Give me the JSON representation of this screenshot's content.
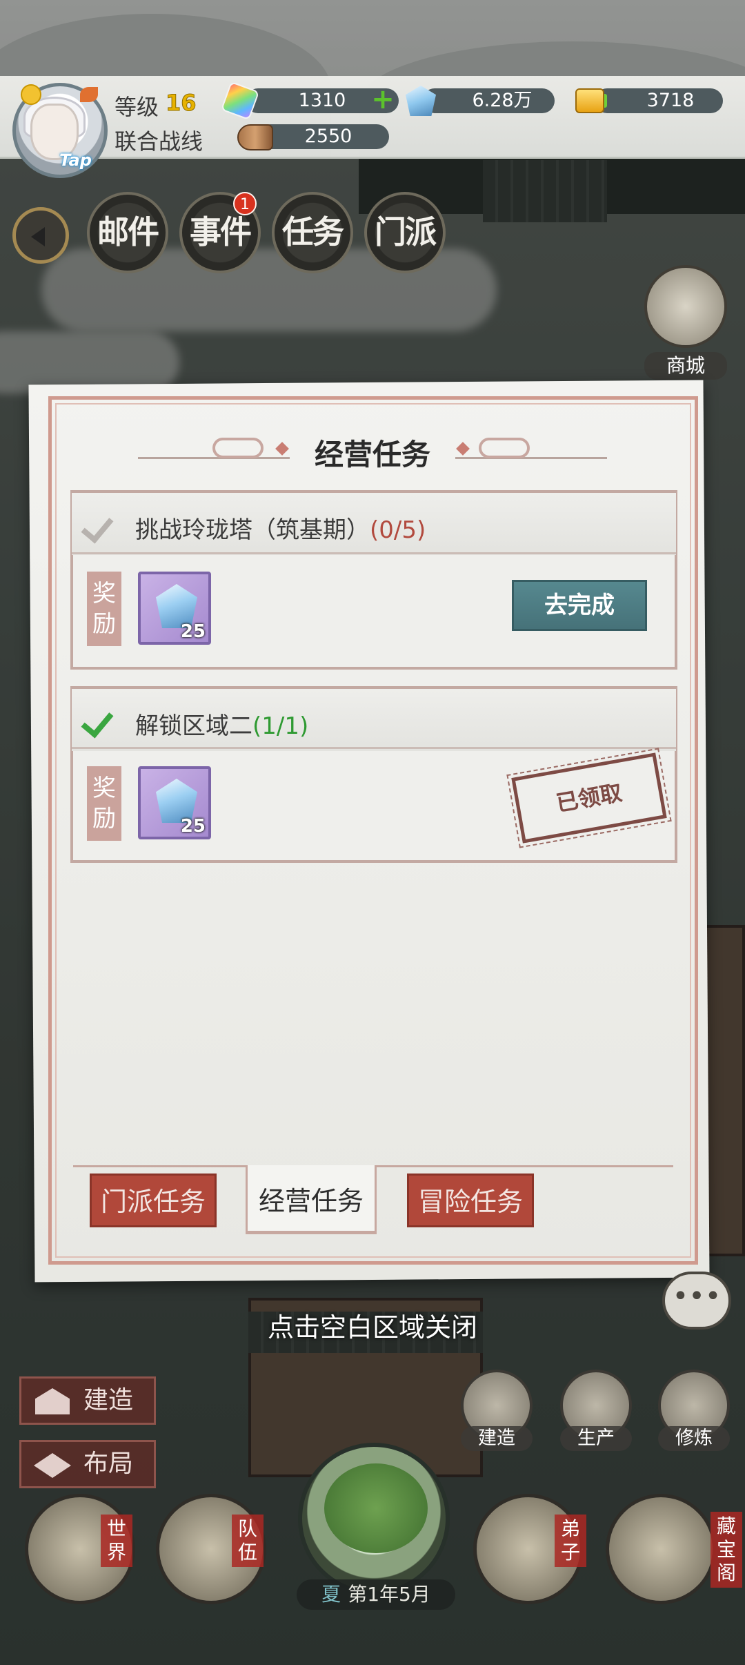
{
  "top_bar": {
    "level_label": "等级",
    "level_value": "16",
    "battle_label": "联合战线",
    "avatar_tag": "Tap",
    "resources": [
      {
        "name": "rainbow-gem",
        "value": "1310",
        "icon": "rainbow-gem-icon"
      },
      {
        "name": "spirit-stone",
        "value": "6.28万",
        "icon": "blue-crystal-icon"
      },
      {
        "name": "gold",
        "value": "3718",
        "icon": "gold-ingot-icon"
      },
      {
        "name": "wood",
        "value": "2550",
        "icon": "wood-log-icon"
      }
    ]
  },
  "nav": {
    "mail": "邮件",
    "event": "事件",
    "event_badge": "1",
    "task": "任务",
    "sect": "门派"
  },
  "side": {
    "shop_label": "商城"
  },
  "dialog": {
    "title": "经营任务",
    "tasks": [
      {
        "title": "挑战玲珑塔（筑基期）",
        "progress": "(0/5)",
        "completed": false,
        "reward_label": "奖励",
        "reward_count": "25",
        "action_label": "去完成"
      },
      {
        "title": "解锁区域二",
        "progress": "(1/1)",
        "completed": true,
        "reward_label": "奖励",
        "reward_count": "25",
        "status_label": "已领取"
      }
    ],
    "tabs": [
      {
        "label": "门派任务",
        "active": false
      },
      {
        "label": "经营任务",
        "active": true
      },
      {
        "label": "冒险任务",
        "active": false
      }
    ],
    "close_hint": "点击空白区域关闭"
  },
  "bottom": {
    "build_label": "建造",
    "layout_label": "布局",
    "build_round_label": "建造",
    "produce_label": "生产",
    "cultivate_label": "修炼",
    "world_label": "世界",
    "team_label": "队伍",
    "disciple_label": "弟子",
    "treasure_label": "藏宝阁",
    "season": "夏",
    "date": "第1年5月"
  },
  "colors": {
    "accent_red": "#b1483a",
    "go_button": "#56888f",
    "progress_red": "#b24a3e",
    "progress_green": "#2f9a32"
  }
}
